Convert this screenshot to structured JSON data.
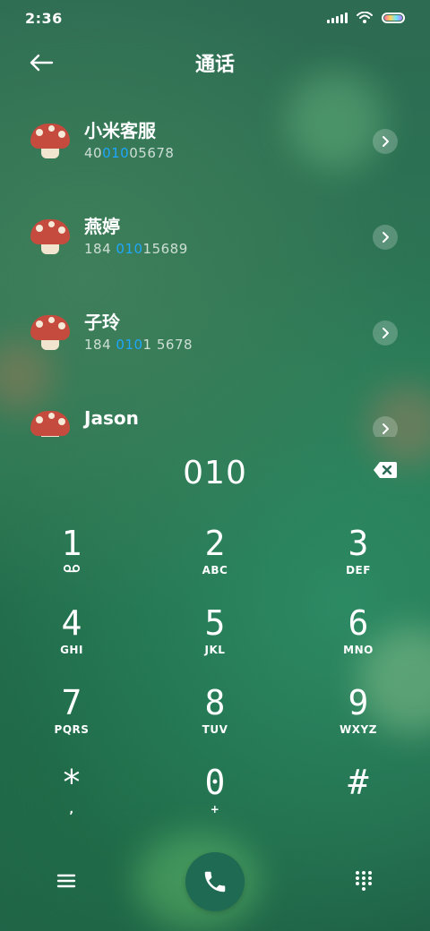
{
  "status": {
    "time": "2:36"
  },
  "header": {
    "title": "通话"
  },
  "contacts": [
    {
      "name": "小米客服",
      "num_pre": "40",
      "num_hl": "010",
      "num_post": "05678"
    },
    {
      "name": "燕婷",
      "num_pre": "184 ",
      "num_hl": "010",
      "num_post": "15689"
    },
    {
      "name": "子玲",
      "num_pre": "184 ",
      "num_hl": "010",
      "num_post": "1 5678"
    },
    {
      "name": "Jason",
      "num_pre": "",
      "num_hl": "",
      "num_post": ""
    }
  ],
  "entry": {
    "digits": "010"
  },
  "keypad": [
    {
      "digit": "1",
      "sub": "ᴼᴼ"
    },
    {
      "digit": "2",
      "sub": "ABC"
    },
    {
      "digit": "3",
      "sub": "DEF"
    },
    {
      "digit": "4",
      "sub": "GHI"
    },
    {
      "digit": "5",
      "sub": "JKL"
    },
    {
      "digit": "6",
      "sub": "MNO"
    },
    {
      "digit": "7",
      "sub": "PQRS"
    },
    {
      "digit": "8",
      "sub": "TUV"
    },
    {
      "digit": "9",
      "sub": "WXYZ"
    },
    {
      "digit": "*",
      "sub": ","
    },
    {
      "digit": "0",
      "sub": "+"
    },
    {
      "digit": "#",
      "sub": ""
    }
  ],
  "icons": {
    "back": "back-arrow-icon",
    "chevron": "chevron-right-icon",
    "backspace": "backspace-icon",
    "menu": "menu-icon",
    "call": "phone-icon",
    "dialpad": "dialpad-icon"
  },
  "colors": {
    "accent": "#1ea7ff",
    "call_button": "#1f6a53"
  }
}
